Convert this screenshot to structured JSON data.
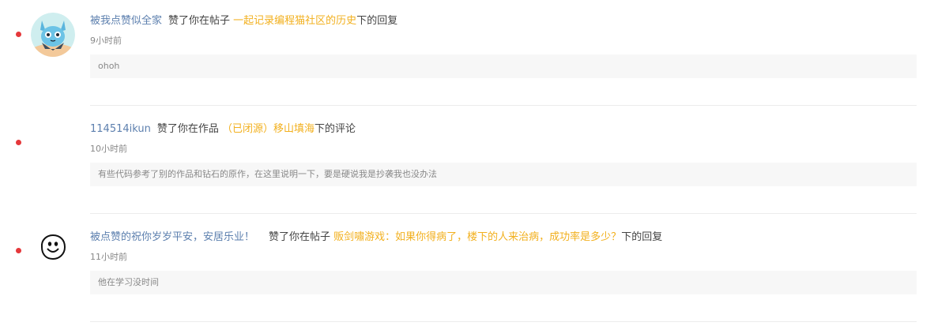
{
  "colors": {
    "unread_dot": "#e5383b",
    "username": "#5c7fae",
    "target_link": "#f2b01e",
    "text": "#444444",
    "muted": "#888888",
    "quote_bg": "#f7f7f7"
  },
  "notifications": [
    {
      "avatar_icon": "blue-cat-mascot-avatar-icon",
      "username": "被我点赞似全家",
      "action": "赞了你在帖子",
      "target": "一起记录编程猫社区的历史",
      "suffix": "下的回复",
      "time": "9小时前",
      "content": "ohoh",
      "unread": true
    },
    {
      "avatar_icon": "no-avatar",
      "username": "114514ikun",
      "action": "赞了你在作品",
      "target": "（已闭源）移山填海",
      "suffix": "下的评论",
      "time": "10小时前",
      "content": "有些代码参考了别的作品和钻石的原作，在这里说明一下，要是硬说我是抄袭我也没办法",
      "unread": true
    },
    {
      "avatar_icon": "smiley-face-doodle-avatar-icon",
      "username": "被点赞的祝你岁岁平安，安居乐业！",
      "action": "赞了你在帖子",
      "target": "贩剑嘯游戏：如果你得病了，楼下的人来治病，成功率是多少？",
      "suffix": "下的回复",
      "time": "11小时前",
      "content": "他在学习没时间",
      "unread": true
    }
  ]
}
